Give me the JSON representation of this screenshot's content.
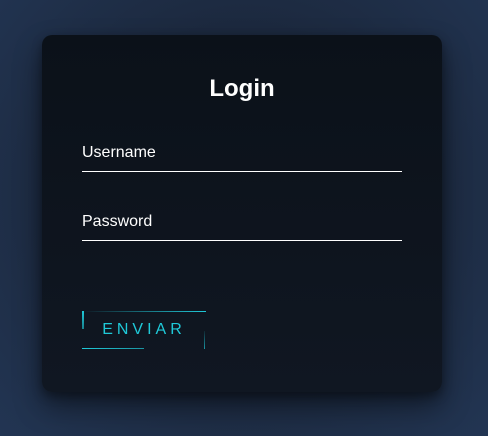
{
  "login": {
    "title": "Login",
    "username": {
      "label": "Username",
      "value": ""
    },
    "password": {
      "label": "Password",
      "value": ""
    },
    "submit_label": "ENVIAR"
  },
  "colors": {
    "accent": "#1fc9d8",
    "card_background": "#0e141d",
    "page_background": "#1d2a40",
    "text": "#ffffff"
  }
}
